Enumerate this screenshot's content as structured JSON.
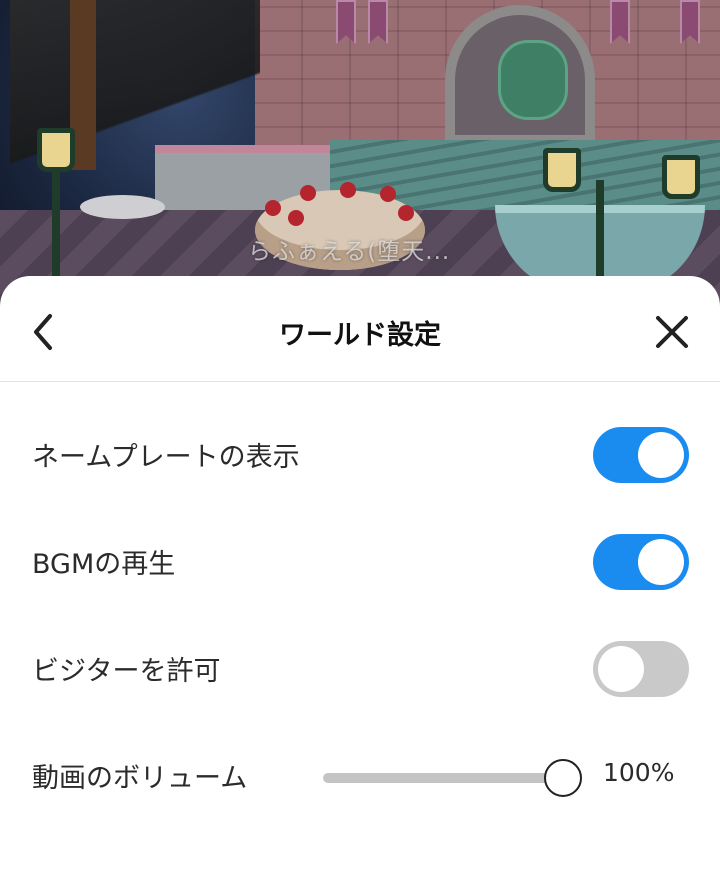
{
  "world": {
    "player_name": "らふぁえる(堕天..."
  },
  "header": {
    "title": "ワールド設定",
    "back_icon": "chevron-left-icon",
    "close_icon": "close-icon"
  },
  "settings": {
    "nameplate": {
      "label": "ネームプレートの表示",
      "enabled": true
    },
    "bgm": {
      "label": "BGMの再生",
      "enabled": true
    },
    "visitors": {
      "label": "ビジターを許可",
      "enabled": false
    },
    "video_volume": {
      "label": "動画のボリューム",
      "value_text": "100%",
      "value": 1.0
    }
  },
  "colors": {
    "toggle_on": "#1a8cf0",
    "toggle_off": "#c9c9c9",
    "slider_track": "#c4c4c4"
  }
}
